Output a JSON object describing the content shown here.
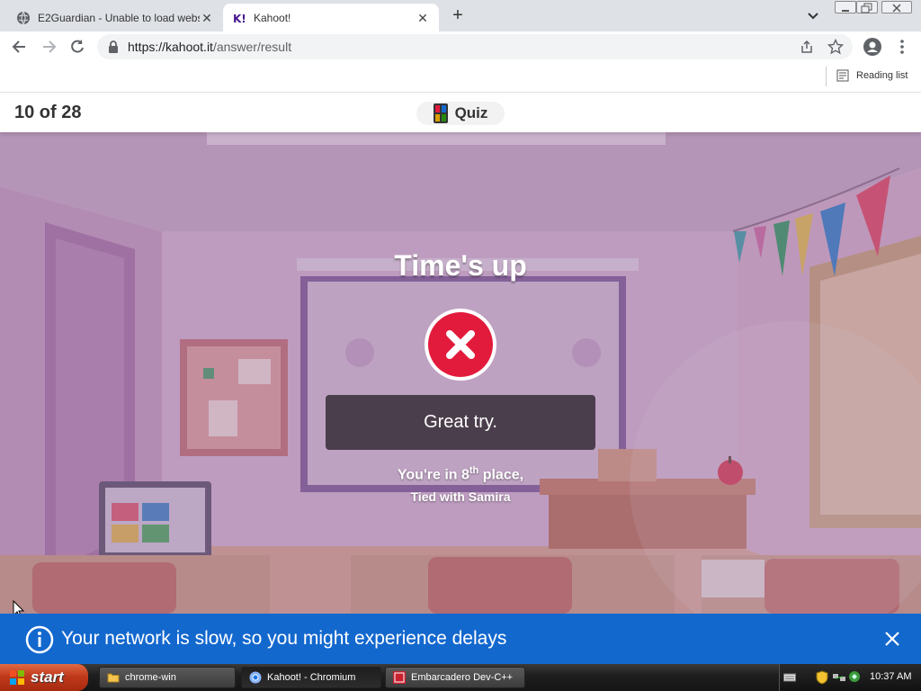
{
  "browser": {
    "tabs": [
      {
        "title": "E2Guardian - Unable to load website",
        "icon": "globe-icon",
        "close": "✕"
      },
      {
        "title": "Kahoot!",
        "icon": "kahoot-favicon",
        "close": "✕"
      }
    ],
    "new_tab_label": "+",
    "url_host": "https://kahoot.it",
    "url_path": "/answer/result",
    "reading_list_label": "Reading list"
  },
  "kahoot": {
    "question_counter": "10 of 28",
    "mode_label": "Quiz",
    "result_title": "Time's up",
    "result_message": "Great try.",
    "place_prefix": "You're in 8",
    "place_suffix": "th",
    "place_tail": " place,",
    "tied_text": "Tied with Samira",
    "incorrect_color": "#e21b3c"
  },
  "network_banner": {
    "message": "Your network is slow, so you might experience delays",
    "color": "#1368ce"
  },
  "taskbar": {
    "start_label": "start",
    "buttons": [
      {
        "label": "chrome-win",
        "icon": "folder-icon"
      },
      {
        "label": "Kahoot! - Chromium",
        "icon": "chromium-icon"
      },
      {
        "label": "Embarcadero Dev-C++",
        "icon": "devcpp-icon"
      }
    ],
    "clock": "10:37 AM"
  }
}
